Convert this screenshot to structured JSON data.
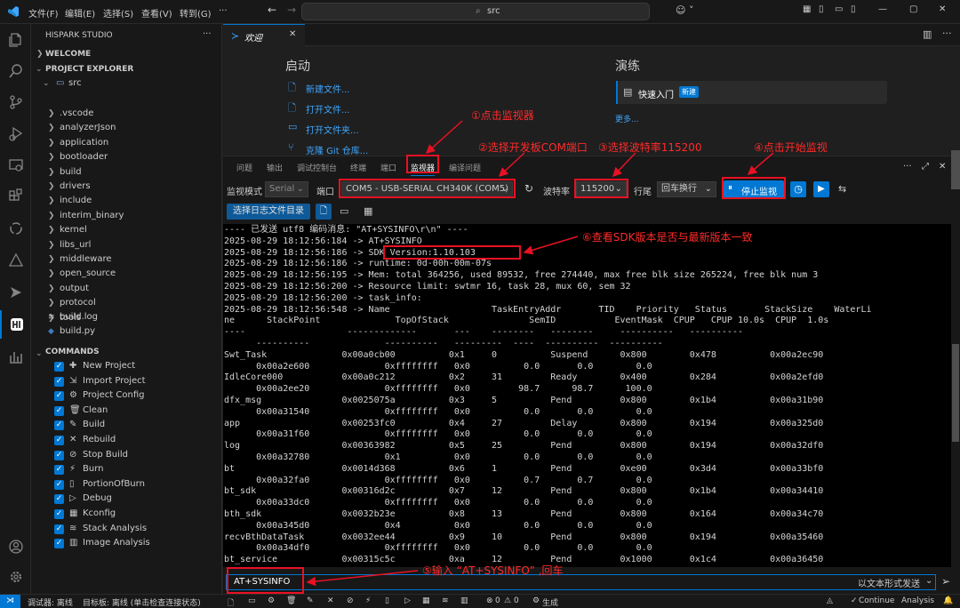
{
  "menu": [
    "文件(F)",
    "编辑(E)",
    "选择(S)",
    "查看(V)",
    "转到(G)"
  ],
  "search": {
    "placeholder": "src"
  },
  "sidebar": {
    "title": "HISPARK STUDIO",
    "welcome": "WELCOME",
    "explorer": "PROJECT EXPLORER",
    "root": "src",
    "folders": [
      ".vscode",
      "analyzerJson",
      "application",
      "bootloader",
      "build",
      "drivers",
      "include",
      "interim_binary",
      "kernel",
      "libs_url",
      "middleware",
      "open_source",
      "output",
      "protocol",
      "tools"
    ],
    "files": [
      "build.log",
      "build.py"
    ],
    "commands_title": "COMMANDS",
    "commands": [
      "New Project",
      "Import Project",
      "Project Config",
      "Clean",
      "Build",
      "Rebuild",
      "Stop Build",
      "Burn",
      "PortionOfBurn",
      "Debug",
      "Kconfig",
      "Stack Analysis",
      "Image Analysis"
    ]
  },
  "editor": {
    "tab": "欢迎",
    "start_title": "启动",
    "start_links": [
      "新建文件...",
      "打开文件...",
      "打开文件夹...",
      "克隆 Git 仓库..."
    ],
    "walk_title": "演练",
    "walk_item": "快速入门",
    "walk_badge": "新建",
    "more": "更多..."
  },
  "panel": {
    "tabs": [
      "问题",
      "输出",
      "调试控制台",
      "终端",
      "端口",
      "监视器",
      "编译问题"
    ],
    "mode_label": "监视模式",
    "mode_value": "Serial",
    "port_label": "端口",
    "port_value": "COM5 - USB-SERIAL CH340K (COM5)",
    "baud_label": "波特率",
    "baud_value": "115200",
    "eol_label": "行尾",
    "eol_value": "回车换行",
    "stop_button": "停止监视",
    "log_button": "选择日志文件目录",
    "input_value": "AT+SYSINFO",
    "send_mode": "以文本形式发送"
  },
  "annotations": {
    "a1": "①点击监视器",
    "a2": "②选择开发板COM端口",
    "a3": "③选择波特率115200",
    "a4": "④点击开始监视",
    "a5": "⑤输入 “AT+SYSINFO” ,回车",
    "a6": "⑥查看SDK版本是否与最新版本一致"
  },
  "terminal_lines": [
    "---- 已发送 utf8 编码消息: \"AT+SYSINFO\\r\\n\" ----",
    "2025-08-29 18:12:56:184 -> AT+SYSINFO",
    "2025-08-29 18:12:56:186 -> SDK Version:1.10.103",
    "2025-08-29 18:12:56:186 -> runtime: 0d-00h-00m-07s",
    "2025-08-29 18:12:56:195 -> Mem: total 364256, used 89532, free 274440, max free blk size 265224, free blk num 3",
    "2025-08-29 18:12:56:200 -> Resource limit: swtmr 16, task 28, mux 60, sem 32",
    "2025-08-29 18:12:56:200 -> task_info:",
    "2025-08-29 18:12:56:548 -> Name                   TaskEntryAddr       TID    Priority   Status       StackSize    WaterLi",
    "ne      StackPoint              TopOfStack               SemID           EventMask  CPUP   CPUP 10.0s  CPUP  1.0s",
    "----                   -------------       ---    --------   --------     ----------   ----------",
    "      ----------              ----------   ---------  ----  ----------  ----------",
    "Swt_Task              0x00a0cb00          0x1     0          Suspend      0x800        0x478          0x00a2ec90",
    "      0x00a2e600              0xffffffff   0x0          0.0       0.0        0.0",
    "IdleCore000           0x00a0c212          0x2     31         Ready        0x400        0x284          0x00a2efd0",
    "      0x00a2ee20              0xffffffff   0x0         98.7      98.7      100.0",
    "dfx_msg               0x0025075a          0x3     5          Pend         0x800        0x1b4          0x00a31b90",
    "      0x00a31540              0xffffffff   0x0          0.0       0.0        0.0",
    "app                   0x00253fc0          0x4     27         Delay        0x800        0x194          0x00a325d0",
    "      0x00a31f60              0xffffffff   0x0          0.0       0.0        0.0",
    "log                   0x00363982          0x5     25         Pend         0x800        0x194          0x00a32df0",
    "      0x00a32780              0x1          0x0          0.0       0.0        0.0",
    "bt                    0x0014d368          0x6     1          Pend         0xe00        0x3d4          0x00a33bf0",
    "      0x00a32fa0              0xffffffff   0x0          0.7       0.7        0.0",
    "bt_sdk                0x00316d2c          0x7     12         Pend         0x800        0x1b4          0x00a34410",
    "      0x00a33dc0              0xffffffff   0x0          0.0       0.0        0.0",
    "bth_sdk               0x0032b23e          0x8     13         Pend         0x800        0x164          0x00a34c70",
    "      0x00a345d0              0x4          0x0          0.0       0.0        0.0",
    "recvBthDataTask       0x0032ee44          0x9     10         Pend         0x800        0x194          0x00a35460",
    "      0x00a34df0              0xffffffff   0x0          0.0       0.0        0.0",
    "bt_service            0x00315c5c          0xa     12         Pend         0x1000       0x1c4          0x00a36450"
  ],
  "status": {
    "debugger": "调试器: 离线",
    "target": "目标板: 离线 (单击检查连接状态)",
    "errors": "0",
    "warnings": "0",
    "build": "生成",
    "continue": "Continue",
    "analysis": "Analysis"
  },
  "colors": {
    "accent": "#0078d4",
    "annotation": "#e81123",
    "terminal_bg": "#000000"
  }
}
